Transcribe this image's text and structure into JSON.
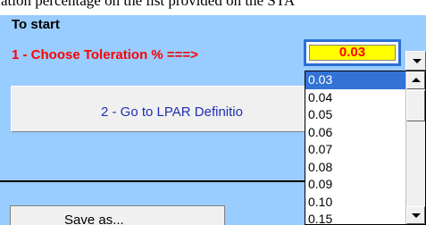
{
  "header_text": "ation percentage on the list provided on the STA",
  "section_title": "To start",
  "toleration": {
    "label": "1 - Choose Toleration % ===>",
    "value": "0.03"
  },
  "dropdown": {
    "options": [
      "0.03",
      "0.04",
      "0.05",
      "0.06",
      "0.07",
      "0.08",
      "0.09",
      "0.10",
      "0.15"
    ],
    "selected_index": 0
  },
  "buttons": {
    "lpar_label": "2 - Go to LPAR Definitio",
    "save_label": "Save as..."
  },
  "colors": {
    "background": "#99ccff",
    "label_red": "#ff0000",
    "value_fill": "#ffff00",
    "selection": "#3373d6",
    "button_text_blue": "#1f2fb2"
  }
}
